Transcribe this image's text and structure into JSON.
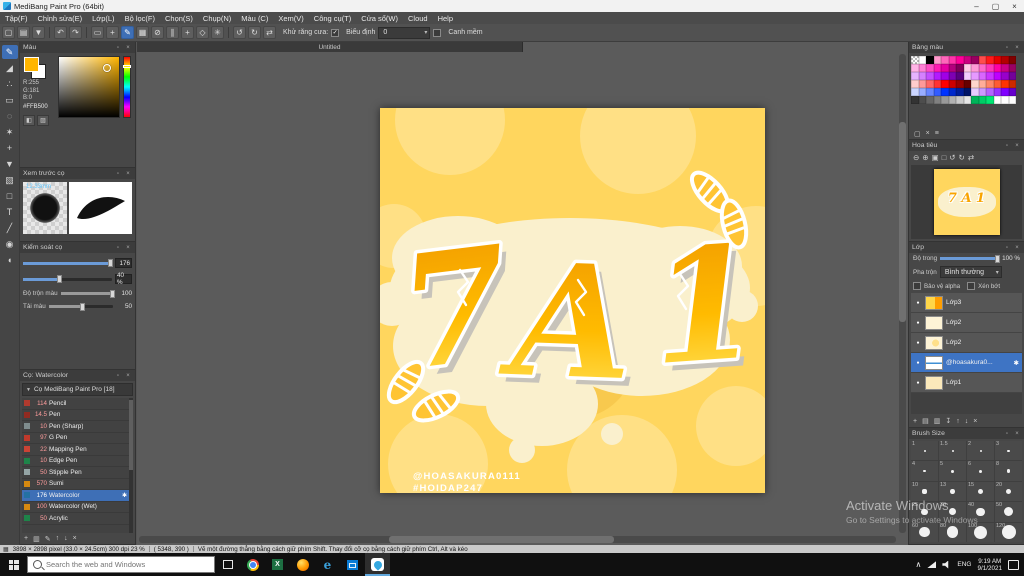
{
  "titlebar": {
    "title": "MediBang Paint Pro (64bit)",
    "minimize": "–",
    "maximize": "▢",
    "close": "×"
  },
  "menubar": {
    "items": [
      "Tập(F)",
      "Chỉnh sửa(E)",
      "Lớp(L)",
      "Bộ lọc(F)",
      "Chọn(S)",
      "Chụp(N)",
      "Màu (C)",
      "Xem(V)",
      "Công cụ(T)",
      "Cửa sổ(W)",
      "Cloud",
      "Help"
    ]
  },
  "toolbar": {
    "icons": [
      {
        "name": "new-file"
      },
      {
        "name": "open-file"
      },
      {
        "name": "save"
      },
      {
        "sep": true
      },
      {
        "name": "undo"
      },
      {
        "name": "redo"
      },
      {
        "sep": true
      },
      {
        "name": "select"
      },
      {
        "name": "move-view"
      },
      {
        "name": "brush",
        "selected": true
      },
      {
        "name": "grid"
      },
      {
        "name": "snap-off"
      },
      {
        "name": "snap-parallel"
      },
      {
        "name": "snap-cross"
      },
      {
        "name": "snap-vanish"
      },
      {
        "name": "snap-radial"
      },
      {
        "sep": true
      },
      {
        "name": "rotate-ccw"
      },
      {
        "name": "rotate-cw"
      },
      {
        "name": "flip"
      }
    ],
    "antialias_label": "Khử răng cưa:",
    "width_label": "Biểu định",
    "width_value": "0",
    "softedge_label": "Canh mềm"
  },
  "tools": {
    "items": [
      {
        "name": "pen",
        "selected": true
      },
      {
        "name": "eraser"
      },
      {
        "name": "finger"
      },
      {
        "name": "select"
      },
      {
        "name": "lasso"
      },
      {
        "name": "magic-wand"
      },
      {
        "name": "move"
      },
      {
        "name": "fill"
      },
      {
        "name": "gradient"
      },
      {
        "name": "shape"
      },
      {
        "name": "text"
      },
      {
        "name": "divide"
      },
      {
        "name": "eyedropper"
      },
      {
        "name": "hand"
      }
    ]
  },
  "panels": {
    "color": {
      "title": "Màu",
      "r": "R:255",
      "g": "G:181",
      "b": "B:0",
      "hex": "#FFB500"
    },
    "brush_preview": {
      "title": "Xem trước cọ",
      "size_label": "12.33mm"
    },
    "brush_control": {
      "title": "Kiểm soát cọ",
      "size_value": "176",
      "opacity_value": "40 %",
      "blend_label": "Độ trộn màu",
      "blend_value": "100",
      "load_label": "Tải màu",
      "load_value": "50"
    },
    "brushes": {
      "title": "Cọ: Watercolor",
      "group_label": "Cọ MediBang Paint Pro [18]",
      "items": [
        {
          "size": "114",
          "name": "Pencil",
          "tag": "#b03a2e"
        },
        {
          "size": "14.5",
          "name": "Pen",
          "tag": "#922b21"
        },
        {
          "size": "10",
          "name": "Pen (Sharp)",
          "tag": "#7f8c8d"
        },
        {
          "size": "97",
          "name": "G Pen",
          "tag": "#c0392b"
        },
        {
          "size": "22",
          "name": "Mapping Pen",
          "tag": "#cb4335"
        },
        {
          "size": "10",
          "name": "Edge Pen",
          "tag": "#1e8449"
        },
        {
          "size": "50",
          "name": "Stipple Pen",
          "tag": "#95a5a6"
        },
        {
          "size": "570",
          "name": "Sumi",
          "tag": "#d68910"
        },
        {
          "size": "176",
          "name": "Watercolor",
          "tag": "#2471a3",
          "selected": true
        },
        {
          "size": "100",
          "name": "Watercolor (Wet)",
          "tag": "#d68910"
        },
        {
          "size": "50",
          "name": "Acrylic",
          "tag": "#1e8449"
        }
      ],
      "ops": [
        {
          "name": "add-brush"
        },
        {
          "name": "duplicate-brush"
        },
        {
          "name": "edit-brush"
        },
        {
          "name": "move-up"
        },
        {
          "name": "move-down"
        },
        {
          "name": "delete-brush"
        }
      ]
    },
    "palette": {
      "title": "Bảng màu",
      "colors": [
        "checker",
        "#ffffff",
        "#000000",
        "#ff99cc",
        "#ff66bb",
        "#ff33aa",
        "#ff0099",
        "#cc0080",
        "#990060",
        "#ff4d4d",
        "#ff1a1a",
        "#e60000",
        "#b30000",
        "#800000",
        "#ffb3e6",
        "#ff80d5",
        "#ff4dc4",
        "#ff1ab3",
        "#e600a1",
        "#b3007d",
        "#800059",
        "#ffcce6",
        "#ff99d6",
        "#ff66c6",
        "#ff33b5",
        "#ff00a5",
        "#cc0084",
        "#990063",
        "#e6b3ff",
        "#d580ff",
        "#c44dff",
        "#b31aff",
        "#a100e6",
        "#7d00b3",
        "#590080",
        "#f2ccff",
        "#e699ff",
        "#d966ff",
        "#cc33ff",
        "#bf00ff",
        "#9900cc",
        "#730099",
        "#ffcccc",
        "#ff9999",
        "#ff6666",
        "#ff3333",
        "#ff0000",
        "#cc0000",
        "#990000",
        "#660000",
        "#ffd6cc",
        "#ffad99",
        "#ff8566",
        "#ff5c33",
        "#ff3300",
        "#cc2900",
        "#ccd6ff",
        "#99adff",
        "#6685ff",
        "#335cff",
        "#0033ff",
        "#0029cc",
        "#001f99",
        "#001566",
        "#e6ccff",
        "#cc99ff",
        "#b366ff",
        "#9933ff",
        "#8000ff",
        "#6600cc",
        "#333333",
        "#4d4d4d",
        "#666666",
        "#808080",
        "#999999",
        "#b3b3b3",
        "#cccccc",
        "#e6e6e6",
        "#00b359",
        "#00cc66",
        "#00e673",
        "#ffffff",
        "#ffffff",
        "#ffffff"
      ],
      "ops": [
        {
          "name": "add-color"
        },
        {
          "name": "delete-color"
        },
        {
          "name": "palette-menu"
        }
      ]
    },
    "navigator": {
      "title": "Hoa tiêu",
      "icons": [
        {
          "name": "zoom-out"
        },
        {
          "name": "zoom-in"
        },
        {
          "name": "fit-screen"
        },
        {
          "name": "actual-pixels"
        },
        {
          "name": "rotate-ccw"
        },
        {
          "name": "rotate-cw"
        },
        {
          "name": "flip"
        }
      ]
    },
    "layers": {
      "title": "Lớp",
      "opacity_label": "Độ trong",
      "opacity_value": "100 %",
      "blend_label": "Pha trộn",
      "blend_value": "Bình thường",
      "alpha_label": "Bảo vệ alpha",
      "clip_label": "Xén bớt",
      "items": [
        {
          "name": "Lớp3",
          "thumb": "t-l3"
        },
        {
          "name": "Lớp2",
          "thumb": "t-l2"
        },
        {
          "name": "Lớp2",
          "thumb": "t-l2b"
        },
        {
          "name": "@hoasakura0...",
          "thumb": "t-sig",
          "selected": true
        },
        {
          "name": "Lớp1",
          "thumb": "t-l1"
        }
      ],
      "ops": [
        {
          "name": "add-layer"
        },
        {
          "name": "add-folder"
        },
        {
          "name": "duplicate-layer"
        },
        {
          "name": "merge-layer"
        },
        {
          "name": "move-up"
        },
        {
          "name": "move-down"
        },
        {
          "name": "delete-layer"
        }
      ]
    },
    "brush_size": {
      "title": "Brush Size",
      "sizes": [
        "1",
        "1.5",
        "2",
        "3",
        "4",
        "5",
        "6",
        "8",
        "10",
        "13",
        "15",
        "20",
        "25",
        "30",
        "40",
        "50",
        "60",
        "80",
        "100",
        "120"
      ]
    }
  },
  "canvas": {
    "tab": "Untitled",
    "text_main": "7 A 1",
    "glyphs": [
      "7",
      "A",
      "1"
    ],
    "credit1": "@HOASAKURA0111",
    "credit2": "#HOIDAP247",
    "bg_color": "#ffd65e",
    "splash_color": "#faf0cd",
    "letter_gradient": [
      "#f09800",
      "#ffbb00",
      "#ffe763"
    ]
  },
  "statusbar": {
    "info": "3898 × 2898 pixel  (33.0 × 24.5cm)  300 dpi  23 %",
    "coords": "( 5348, 390 )",
    "tip": "Vẽ một đường thẳng bằng cách giữ phím Shift. Thay đổi cỡ cọ bằng cách giữ phím Ctrl, Alt và kéo"
  },
  "watermark": {
    "line1": "Activate Windows",
    "line2": "Go to Settings to activate Windows"
  },
  "taskbar": {
    "search_placeholder": "Search the web and Windows",
    "apps": [
      {
        "name": "task-view"
      },
      {
        "name": "chrome"
      },
      {
        "name": "excel"
      },
      {
        "name": "firefox"
      },
      {
        "name": "edge"
      },
      {
        "name": "store"
      },
      {
        "name": "medibang",
        "active": true
      }
    ],
    "lang": "ENG",
    "time": "9:19 AM",
    "date": "9/1/2021"
  }
}
